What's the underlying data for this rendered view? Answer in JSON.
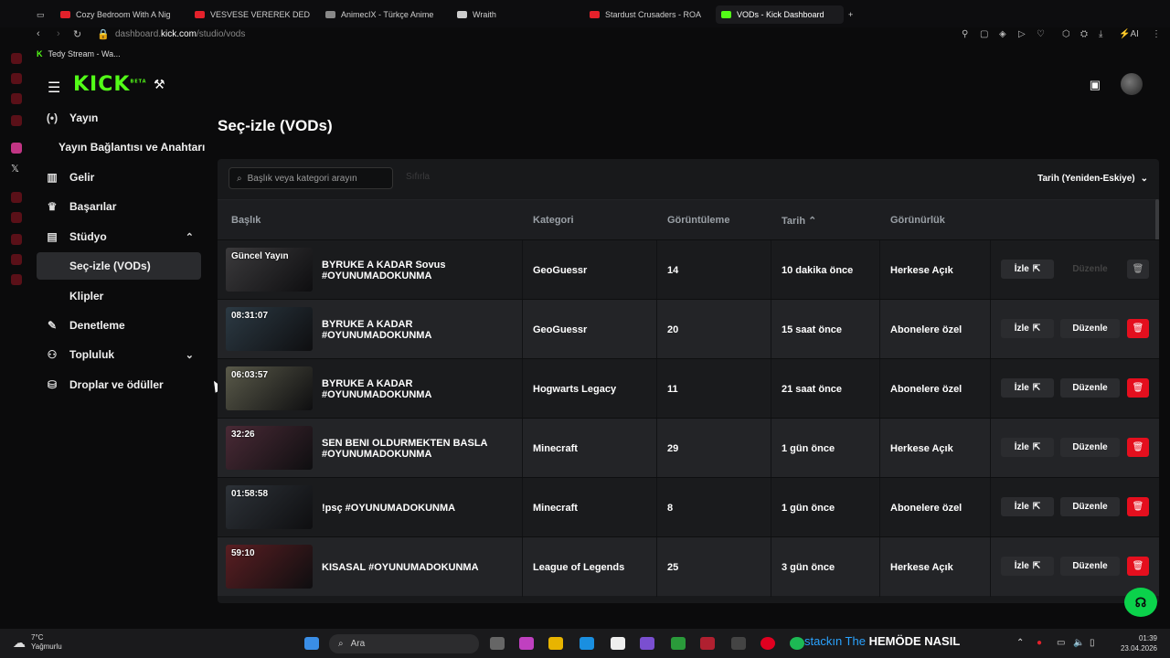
{
  "browser": {
    "tabs": [
      {
        "label": "Cozy Bedroom With A Nig",
        "fav": "#e4212b"
      },
      {
        "label": "VESVESE VEREREK DEDE",
        "fav": "#e4212b"
      },
      {
        "label": "AnimecIX - Türkçe Anime",
        "fav": "#888888"
      },
      {
        "label": "Wraith",
        "fav": "#cccccc"
      },
      {
        "label": "Stardust Crusaders - ROA",
        "fav": "#e4212b"
      },
      {
        "label": "VODs - Kick Dashboard",
        "fav": "#53fc18"
      }
    ],
    "url_prefix": "dashboard.",
    "url_host": "kick.com",
    "url_path": "/studio/vods",
    "ai_label": "AI",
    "bookmark": "Tedy Stream - Wa..."
  },
  "header": {
    "logo": "KICK",
    "logo_badge": "BETA"
  },
  "sidebar": {
    "items": [
      {
        "label": "Yayın",
        "icon": "broadcast-icon",
        "glyph": "(•)"
      },
      {
        "label": "Yayın Bağlantısı ve Anahtarı",
        "icon": "",
        "glyph": ""
      },
      {
        "label": "Gelir",
        "icon": "chart-icon",
        "glyph": "▥"
      },
      {
        "label": "Başarılar",
        "icon": "trophy-icon",
        "glyph": "🏆"
      },
      {
        "label": "Stüdyo",
        "icon": "film-icon",
        "glyph": "▤"
      },
      {
        "label": "Seç-izle (VODs)",
        "icon": "",
        "glyph": ""
      },
      {
        "label": "Klipler",
        "icon": "",
        "glyph": ""
      },
      {
        "label": "Denetleme",
        "icon": "wrench-icon",
        "glyph": "🔧"
      },
      {
        "label": "Topluluk",
        "icon": "people-icon",
        "glyph": "👥"
      },
      {
        "label": "Droplar ve ödüller",
        "icon": "gift-icon",
        "glyph": "⛁"
      }
    ]
  },
  "main": {
    "title": "Seç-izle (VODs)",
    "search_placeholder": "Başlık veya kategori arayın",
    "filter_label": "Sıfırla",
    "sort_label": "Tarih (Yeniden-Eskiye)",
    "columns": {
      "title": "Başlık",
      "category": "Kategori",
      "views": "Görüntüleme",
      "date": "Tarih",
      "visibility": "Görünürlük"
    },
    "watch_label": "İzle",
    "edit_label": "Düzenle",
    "rows": [
      {
        "duration": "Güncel Yayın",
        "title": "BYRUKE A KADAR Sovus #OYUNUMADOKUNMA",
        "category": "GeoGuessr",
        "views": "14",
        "date": "10 dakika önce",
        "visibility": "Herkese Açık",
        "thumb": "#3b3a3c",
        "live": true
      },
      {
        "duration": "08:31:07",
        "title": "BYRUKE A KADAR #OYUNUMADOKUNMA",
        "category": "GeoGuessr",
        "views": "20",
        "date": "15 saat önce",
        "visibility": "Abonelere özel",
        "thumb": "#2c3a44",
        "live": false
      },
      {
        "duration": "06:03:57",
        "title": "BYRUKE A KADAR #OYUNUMADOKUNMA",
        "category": "Hogwarts Legacy",
        "views": "11",
        "date": "21 saat önce",
        "visibility": "Abonelere özel",
        "thumb": "#5a5a4a",
        "live": false
      },
      {
        "duration": "32:26",
        "title": "SEN BENI OLDURMEKTEN BASLA #OYUNUMADOKUNMA",
        "category": "Minecraft",
        "views": "29",
        "date": "1 gün önce",
        "visibility": "Herkese Açık",
        "thumb": "#4a2a36",
        "live": false
      },
      {
        "duration": "01:58:58",
        "title": "!psç #OYUNUMADOKUNMA",
        "category": "Minecraft",
        "views": "8",
        "date": "1 gün önce",
        "visibility": "Abonelere özel",
        "thumb": "#2d3238",
        "live": false
      },
      {
        "duration": "59:10",
        "title": "KISASAL #OYUNUMADOKUNMA",
        "category": "League of Legends",
        "views": "25",
        "date": "3 gün önce",
        "visibility": "Herkese Açık",
        "thumb": "#5a1e22",
        "live": false
      }
    ]
  },
  "taskbar": {
    "temp": "7°C",
    "weather": "Yağmurlu",
    "search": "Ara",
    "marquee_blue": "stackın The",
    "marquee": "HEMÖDE NASIL",
    "time": "01:39",
    "date": "23.04.2026"
  }
}
